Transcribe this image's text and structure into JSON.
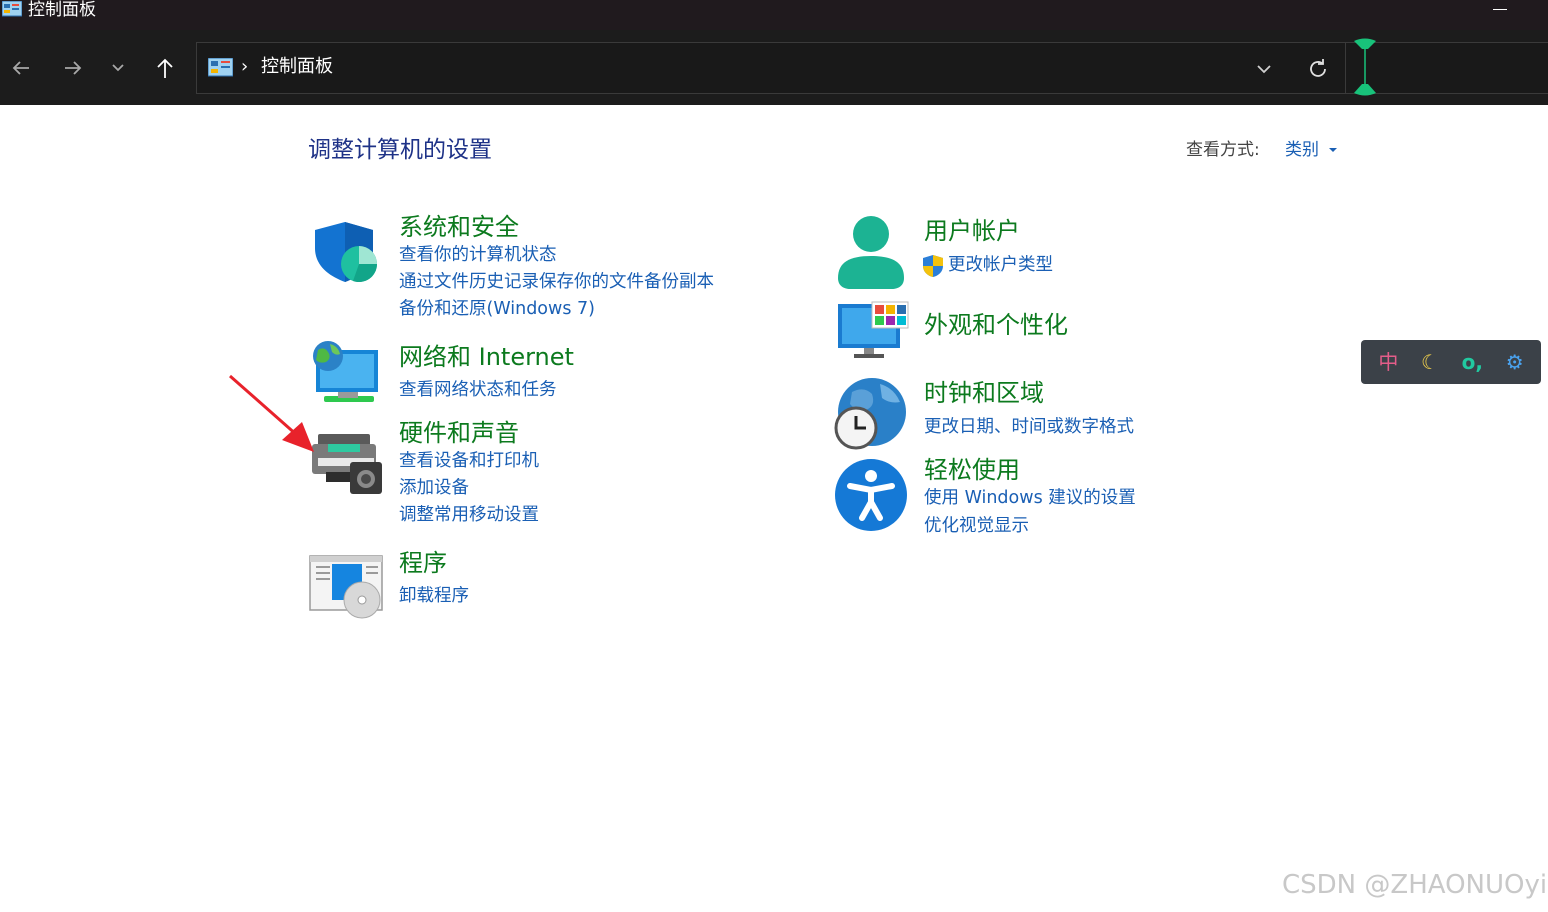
{
  "window": {
    "title": "控制面板"
  },
  "address_bar": {
    "separator": "›",
    "crumb": "控制面板"
  },
  "main": {
    "title": "调整计算机的设置",
    "view_by": {
      "label": "查看方式:",
      "value": "类别"
    },
    "categories_left": [
      {
        "title": "系统和安全",
        "icon": "shield-icon",
        "links": [
          "查看你的计算机状态",
          "通过文件历史记录保存你的文件备份副本",
          "备份和还原(Windows 7)"
        ]
      },
      {
        "title": "网络和 Internet",
        "icon": "network-icon",
        "links": [
          "查看网络状态和任务"
        ]
      },
      {
        "title": "硬件和声音",
        "icon": "printer-icon",
        "links": [
          "查看设备和打印机",
          "添加设备",
          "调整常用移动设置"
        ]
      },
      {
        "title": "程序",
        "icon": "programs-icon",
        "links": [
          "卸载程序"
        ]
      }
    ],
    "categories_right": [
      {
        "title": "用户帐户",
        "icon": "user-icon",
        "links": [
          "更改帐户类型"
        ]
      },
      {
        "title": "外观和个性化",
        "icon": "monitor-icon",
        "links": []
      },
      {
        "title": "时钟和区域",
        "icon": "globe-clock-icon",
        "links": [
          "更改日期、时间或数字格式"
        ]
      },
      {
        "title": "轻松使用",
        "icon": "accessibility-icon",
        "links": [
          "使用 Windows 建议的设置",
          "优化视觉显示"
        ]
      }
    ]
  },
  "ime_toolbar": {
    "lang": "中",
    "moon": "☾",
    "punct": "o,",
    "gear": "⚙"
  },
  "watermark": "CSDN @ZHAONUOyi",
  "colors": {
    "title_bar": "#201a1e",
    "nav_bar": "#1c1c1c",
    "category_title": "#0c7a1e",
    "link": "#1a5fb4",
    "page_title": "#1e3287",
    "annotation_arrow": "#e8222b"
  }
}
